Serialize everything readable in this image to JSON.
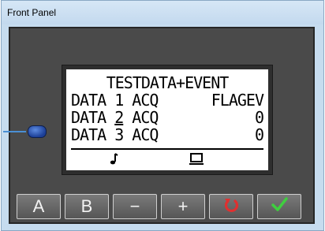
{
  "window": {
    "title": "Front Panel"
  },
  "lcd": {
    "heading": "TESTDATA+EVENT",
    "rows": [
      {
        "left": "DATA 1 ACQ",
        "right": "FLAGEV"
      },
      {
        "left_prefix": "DATA ",
        "left_underlined": "2",
        "left_suffix": " ACQ",
        "right": "0"
      },
      {
        "left": "DATA 3 ACQ",
        "right": "0"
      }
    ],
    "status_icons": [
      "note-icon",
      "computer-icon"
    ]
  },
  "led": {
    "color": "#2a56c6"
  },
  "buttons": {
    "a_label": "A",
    "b_label": "B",
    "minus_label": "−",
    "plus_label": "+",
    "undo_icon": "undo-arrow-icon",
    "undo_color": "#e03030",
    "confirm_icon": "check-icon",
    "confirm_color": "#3fcf3f"
  }
}
